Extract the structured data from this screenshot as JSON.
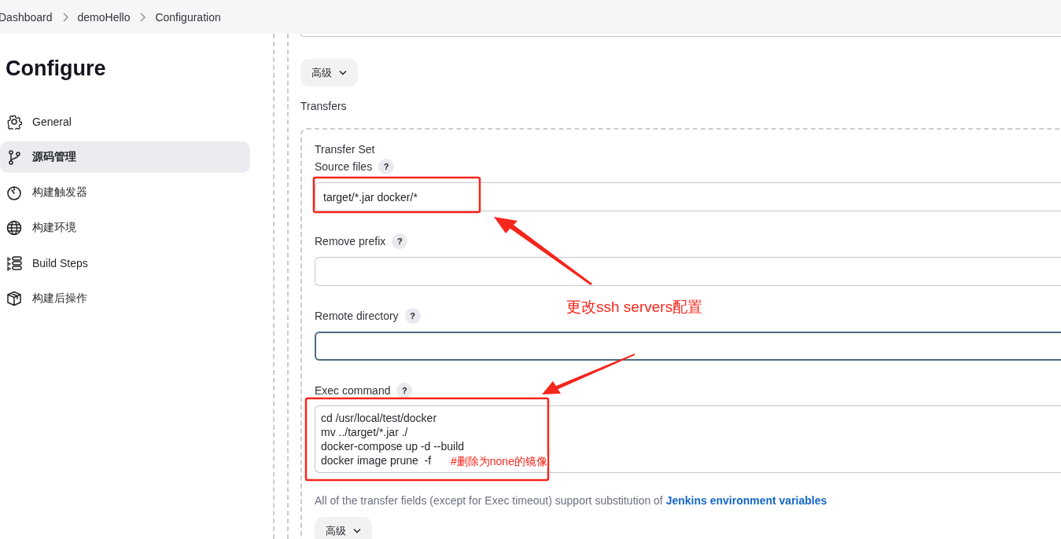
{
  "breadcrumb": [
    "Dashboard",
    "demoHello",
    "Configuration"
  ],
  "sidebar": {
    "title": "Configure",
    "items": [
      {
        "label": "General",
        "selected": false
      },
      {
        "label": "源码管理",
        "selected": true
      },
      {
        "label": "构建触发器",
        "selected": false
      },
      {
        "label": "构建环境",
        "selected": false
      },
      {
        "label": "Build Steps",
        "selected": false
      },
      {
        "label": "构建后操作",
        "selected": false
      }
    ]
  },
  "main": {
    "advanced_button": "高级",
    "section_label": "Transfers",
    "transfer_set": {
      "title": "Transfer Set",
      "fields": [
        {
          "kind": "input",
          "label": "Source files",
          "help": "?",
          "value": "target/*.jar docker/*",
          "focused": false
        },
        {
          "kind": "input",
          "label": "Remove prefix",
          "help": "?",
          "focused": false
        },
        {
          "kind": "input",
          "label": "Remote directory",
          "help": "?",
          "focused": true
        },
        {
          "kind": "textarea",
          "label": "Exec command",
          "help": "?",
          "lines": [
            "cd /usr/local/test/docker",
            "mv ../target/*.jar ./",
            "docker-compose up -d --build",
            "docker image prune  -f"
          ],
          "focused": false
        }
      ],
      "help_text": {
        "text": "All of the transfer fields (except for Exec timeout) support substitution of",
        "link": "Jenkins environment variables"
      },
      "advanced_button": "高级"
    }
  },
  "annotations": {
    "labels": [
      "更改ssh servers配置",
      "#删除为none的镜像"
    ]
  }
}
